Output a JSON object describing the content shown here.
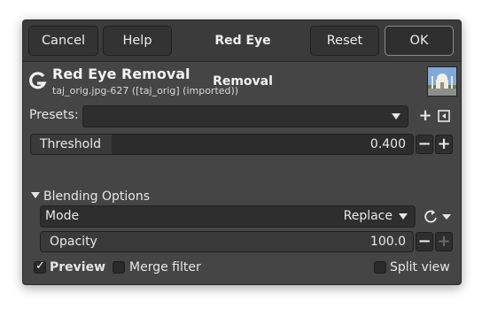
{
  "header": {
    "cancel_label": "Cancel",
    "help_label": "Help",
    "title": "Red Eye Removal",
    "reset_label": "Reset",
    "ok_label": "OK"
  },
  "operation": {
    "title": "Red Eye Removal",
    "subtitle": "taj_orig.jpg-627 ([taj_orig] (imported))",
    "logo_icon": "gimp-logo-icon"
  },
  "presets": {
    "label": "Presets:",
    "value": "",
    "add_icon": "plus-icon",
    "menu_icon": "preset-menu-icon"
  },
  "threshold": {
    "label": "Threshold",
    "value": "0.400",
    "fraction": 0.4
  },
  "blending": {
    "section_label": "Blending Options",
    "mode_label": "Mode",
    "mode_value": "Replace",
    "opacity_label": "Opacity",
    "opacity_value": "100.0",
    "opacity_fraction": 1.0
  },
  "footer": {
    "preview_label": "Preview",
    "preview_checked": true,
    "merge_label": "Merge filter",
    "merge_checked": false,
    "split_label": "Split view",
    "split_checked": false
  }
}
